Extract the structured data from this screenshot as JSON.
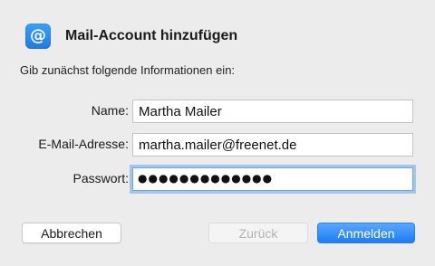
{
  "dialog": {
    "title": "Mail-Account hinzufügen",
    "icon": "at-sign-icon",
    "icon_glyph": "@",
    "intro": "Gib zunächst folgende Informationen ein:"
  },
  "form": {
    "name_label": "Name:",
    "name_value": "Martha Mailer",
    "email_label": "E-Mail-Adresse:",
    "email_value": "martha.mailer@freenet.de",
    "password_label": "Passwort:",
    "password_masked": "●●●●●●●●●●●●●"
  },
  "buttons": {
    "cancel": "Abbrechen",
    "back": "Zurück",
    "login": "Anmelden"
  },
  "colors": {
    "accent": "#1d7df4",
    "focus_ring": "#6aa8ee",
    "background": "#ececec"
  }
}
